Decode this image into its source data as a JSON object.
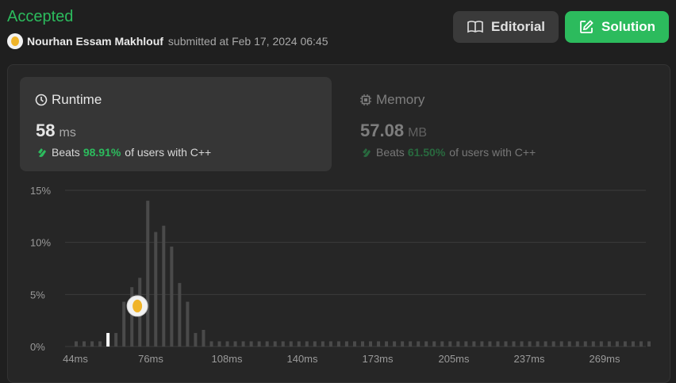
{
  "header": {
    "status": "Accepted",
    "author": "Nourhan Essam Makhlouf",
    "submitted_text": "submitted at Feb 17, 2024 06:45"
  },
  "buttons": {
    "editorial": "Editorial",
    "solution": "Solution"
  },
  "runtime": {
    "title": "Runtime",
    "value": "58",
    "unit": "ms",
    "beats_label": "Beats",
    "beats_pct": "98.91%",
    "beats_suffix": "of users with C++"
  },
  "memory": {
    "title": "Memory",
    "value": "57.08",
    "unit": "MB",
    "beats_label": "Beats",
    "beats_pct": "61.50%",
    "beats_suffix": "of users with C++"
  },
  "colors": {
    "accent_green": "#2cbb5d",
    "bar": "#4a4a4a",
    "highlight_bar": "#ffffff"
  },
  "chart_data": {
    "type": "bar",
    "ylabels": [
      "15%",
      "10%",
      "5%",
      "0%"
    ],
    "ylim": [
      0,
      15
    ],
    "x_ticks": [
      "44ms",
      "76ms",
      "108ms",
      "140ms",
      "173ms",
      "205ms",
      "237ms",
      "269ms"
    ],
    "highlight_index": 4,
    "values": [
      0.5,
      0.5,
      0.5,
      0.5,
      1.3,
      1.3,
      4.3,
      5.7,
      6.6,
      14,
      11,
      11.6,
      9.6,
      6.1,
      4.3,
      1.3,
      1.6,
      0.5,
      0.5,
      0.5,
      0.5,
      0.5,
      0.5,
      0.5,
      0.5,
      0.5,
      0.5,
      0.5,
      0.5,
      0.5,
      0.5,
      0.5,
      0.5,
      0.5,
      0.5,
      0.5,
      0.5,
      0.5,
      0.5,
      0.5,
      0.5,
      0.5,
      0.5,
      0.5,
      0.5,
      0.5,
      0.5,
      0.5,
      0.5,
      0.5,
      0.5,
      0.5,
      0.5,
      0.5,
      0.5,
      0.5,
      0.5,
      0.5,
      0.5,
      0.5,
      0.5,
      0.5,
      0.5,
      0.5,
      0.5,
      0.5,
      0.5,
      0.5,
      0.5,
      0.5,
      0.5,
      0.5,
      0.5
    ]
  }
}
